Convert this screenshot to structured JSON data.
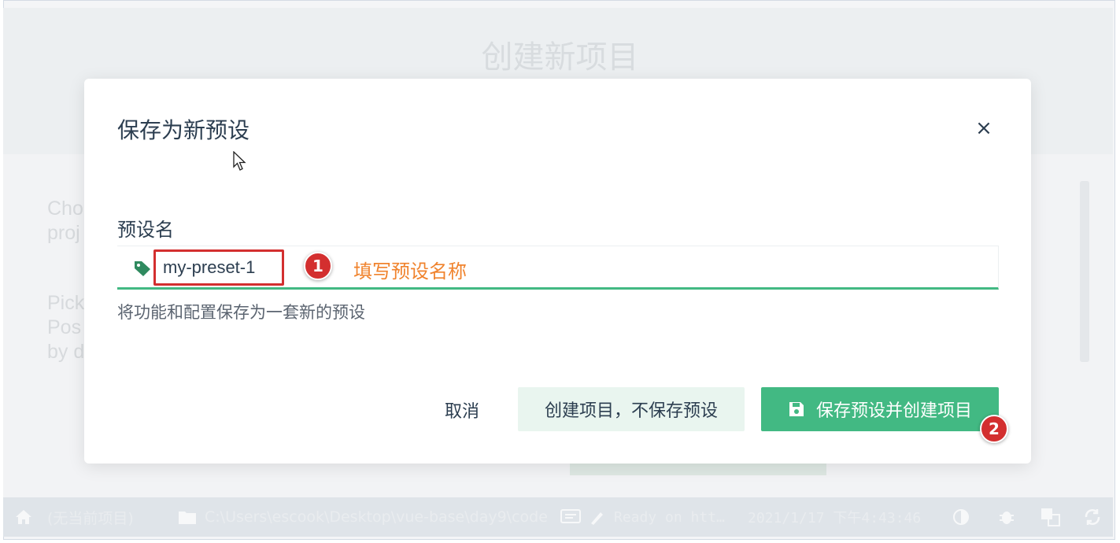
{
  "background": {
    "page_title": "创建新项目",
    "text_1": "Cho\nproj",
    "text_2": "Pick\nPos\nby d"
  },
  "statusbar": {
    "home_icon": "home-icon",
    "project": "(无当前项目)",
    "folder_icon": "folder-icon",
    "path": "C:\\Users\\escook\\Desktop\\vue-base\\day9\\code",
    "log_icon": "terminal-icon",
    "brush_icon": "brush-icon",
    "log_text": "Ready on htt…",
    "timestamp": "2021/1/17 下午4:43:46",
    "theme_icon": "contrast-icon",
    "bug_icon": "bug-icon",
    "translate_icon": "translate-icon",
    "refresh_icon": "refresh-icon"
  },
  "dialog": {
    "title": "保存为新预设",
    "close_label": "×",
    "field_label": "预设名",
    "input_value": "my-preset-1",
    "annotation_1": "1",
    "annotation_1_text": "填写预设名称",
    "help_text": "将功能和配置保存为一套新的预设",
    "cancel_label": "取消",
    "create_no_save_label": "创建项目，不保存预设",
    "save_and_create_label": "保存预设并创建项目",
    "annotation_2": "2"
  },
  "colors": {
    "accent": "#42b983",
    "annotation": "#d32f2f",
    "annotation_text": "#f0832d",
    "text": "#2c3e50"
  }
}
